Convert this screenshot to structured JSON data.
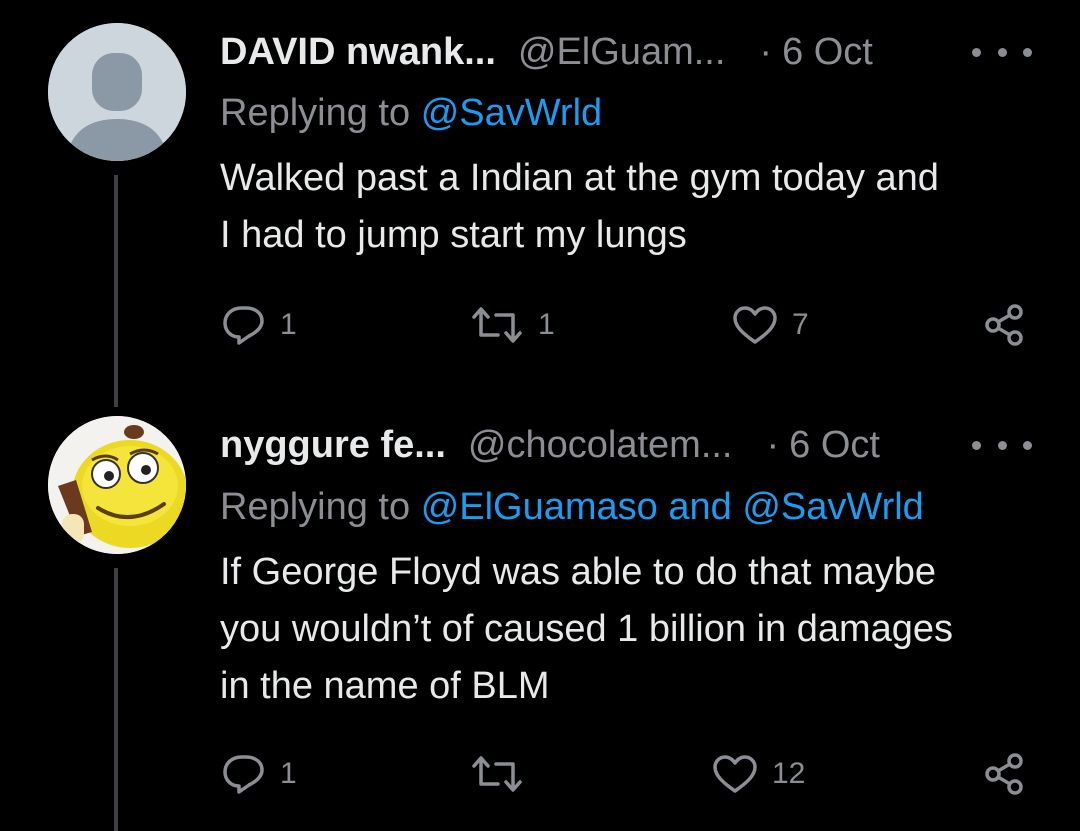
{
  "tweets": [
    {
      "name": "DAVID nwank...",
      "handle": "@ElGuam...",
      "dot": "·",
      "date": "6 Oct",
      "replying_prefix": "Replying to",
      "mention_1": "@SavWrld",
      "mention_joiner": "",
      "mention_2": "",
      "lines": [
        "Walked past a Indian at the gym today and",
        "I had to jump start my lungs"
      ],
      "reply_count": "1",
      "retweet_count": "1",
      "like_count": "7",
      "avatar": "default-avatar-icon"
    },
    {
      "name": "nyggure fe...",
      "handle": "@chocolatem...",
      "dot": "·",
      "date": "6 Oct",
      "replying_prefix": "Replying to",
      "mention_1": "@ElGuamaso",
      "mention_joiner": "and",
      "mention_2": "@SavWrld",
      "lines": [
        "If George Floyd was able to do that maybe",
        "you wouldn’t of caused 1 billion in damages",
        "in the name of BLM"
      ],
      "reply_count": "1",
      "retweet_count": "",
      "like_count": "12",
      "avatar": "yellow-emoji-avatar"
    }
  ],
  "colors": {
    "background": "#000000",
    "text": "#e7e9ea",
    "secondary": "#8b8f94",
    "link": "#1d9bf0",
    "thread_line": "#3e4144"
  }
}
